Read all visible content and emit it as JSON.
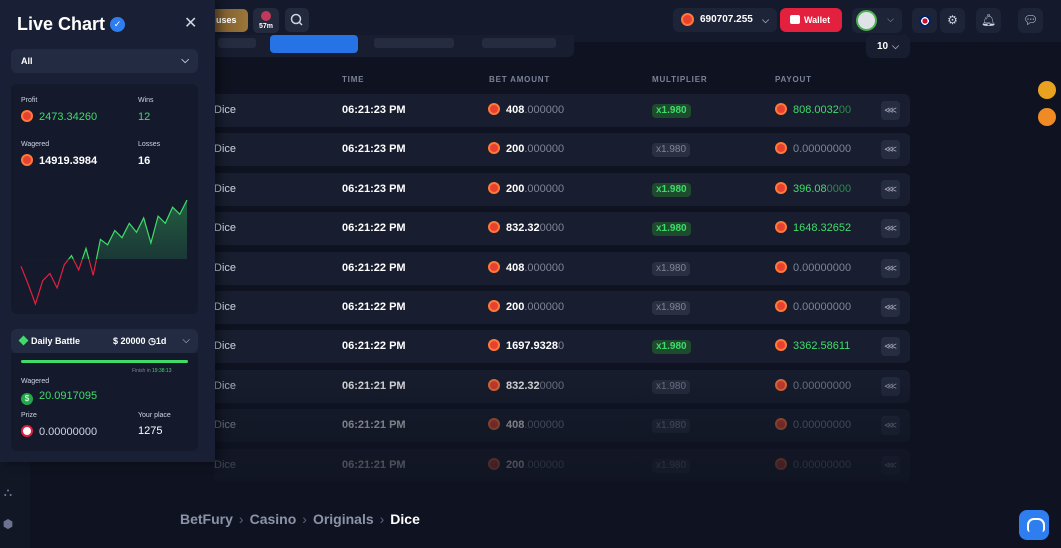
{
  "header": {
    "bonus_label": "uses",
    "timer_label": "57m",
    "balance": "690707.255",
    "wallet_label": "Wallet"
  },
  "filters": {
    "rows_per_page": "10"
  },
  "table": {
    "columns": [
      "TIME",
      "BET AMOUNT",
      "MULTIPLIER",
      "PAYOUT"
    ],
    "rows": [
      {
        "game": "Dice",
        "time": "06:21:23 PM",
        "bet_main": "408",
        "bet_dim": ".000000",
        "multiplier": "x1.980",
        "win": true,
        "payout_main": "808.0032",
        "payout_dim": "00"
      },
      {
        "game": "Dice",
        "time": "06:21:23 PM",
        "bet_main": "200",
        "bet_dim": ".000000",
        "multiplier": "x1.980",
        "win": false,
        "payout_main": "0.00000000",
        "payout_dim": ""
      },
      {
        "game": "Dice",
        "time": "06:21:23 PM",
        "bet_main": "200",
        "bet_dim": ".000000",
        "multiplier": "x1.980",
        "win": true,
        "payout_main": "396.08",
        "payout_dim": "0000"
      },
      {
        "game": "Dice",
        "time": "06:21:22 PM",
        "bet_main": "832.32",
        "bet_dim": "0000",
        "multiplier": "x1.980",
        "win": true,
        "payout_main": "1648.32652",
        "payout_dim": ""
      },
      {
        "game": "Dice",
        "time": "06:21:22 PM",
        "bet_main": "408",
        "bet_dim": ".000000",
        "multiplier": "x1.980",
        "win": false,
        "payout_main": "0.00000000",
        "payout_dim": ""
      },
      {
        "game": "Dice",
        "time": "06:21:22 PM",
        "bet_main": "200",
        "bet_dim": ".000000",
        "multiplier": "x1.980",
        "win": false,
        "payout_main": "0.00000000",
        "payout_dim": ""
      },
      {
        "game": "Dice",
        "time": "06:21:22 PM",
        "bet_main": "1697.9328",
        "bet_dim": "0",
        "multiplier": "x1.980",
        "win": true,
        "payout_main": "3362.58611",
        "payout_dim": ""
      },
      {
        "game": "Dice",
        "time": "06:21:21 PM",
        "bet_main": "832.32",
        "bet_dim": "0000",
        "multiplier": "x1.980",
        "win": false,
        "payout_main": "0.00000000",
        "payout_dim": ""
      },
      {
        "game": "Dice",
        "time": "06:21:21 PM",
        "bet_main": "408",
        "bet_dim": ".000000",
        "multiplier": "x1.980",
        "win": false,
        "payout_main": "0.00000000",
        "payout_dim": ""
      },
      {
        "game": "Dice",
        "time": "06:21:21 PM",
        "bet_main": "200",
        "bet_dim": ".000000",
        "multiplier": "x1.980",
        "win": false,
        "payout_main": "0.00000000",
        "payout_dim": ""
      }
    ]
  },
  "breadcrumb": [
    "BetFury",
    "Casino",
    "Originals",
    "Dice"
  ],
  "live_chart": {
    "title": "Live Chart",
    "filter": "All",
    "profit_label": "Profit",
    "profit": "2473.34260",
    "wins_label": "Wins",
    "wins": "12",
    "wagered_label": "Wagered",
    "wagered": "14919.3984",
    "losses_label": "Losses",
    "losses": "16",
    "series": [
      {
        "x": 0,
        "y": -40
      },
      {
        "x": 1,
        "y": -140
      },
      {
        "x": 2,
        "y": -250
      },
      {
        "x": 3,
        "y": -120
      },
      {
        "x": 4,
        "y": -80
      },
      {
        "x": 5,
        "y": -160
      },
      {
        "x": 6,
        "y": -30
      },
      {
        "x": 7,
        "y": 20
      },
      {
        "x": 8,
        "y": -60
      },
      {
        "x": 9,
        "y": 60
      },
      {
        "x": 10,
        "y": -90
      },
      {
        "x": 11,
        "y": 110
      },
      {
        "x": 12,
        "y": 80
      },
      {
        "x": 13,
        "y": 160
      },
      {
        "x": 14,
        "y": 120
      },
      {
        "x": 15,
        "y": 200
      },
      {
        "x": 16,
        "y": 150
      },
      {
        "x": 17,
        "y": 230
      },
      {
        "x": 18,
        "y": 90
      },
      {
        "x": 19,
        "y": 240
      },
      {
        "x": 20,
        "y": 200
      },
      {
        "x": 21,
        "y": 290
      },
      {
        "x": 22,
        "y": 250
      },
      {
        "x": 23,
        "y": 330
      }
    ],
    "colors": {
      "positive": "#3fdc6a",
      "negative": "#e3203e"
    }
  },
  "daily_battle": {
    "label": "Daily Battle",
    "prize_pool": "$ 20000",
    "period": "1d",
    "progress": 1.0,
    "finish_label": "Finish in",
    "finish_time": "19:38:13",
    "wagered_label": "Wagered",
    "wagered": "20.0917095",
    "prize_label": "Prize",
    "prize": "0.00000000",
    "place_label": "Your place",
    "place": "1275"
  }
}
